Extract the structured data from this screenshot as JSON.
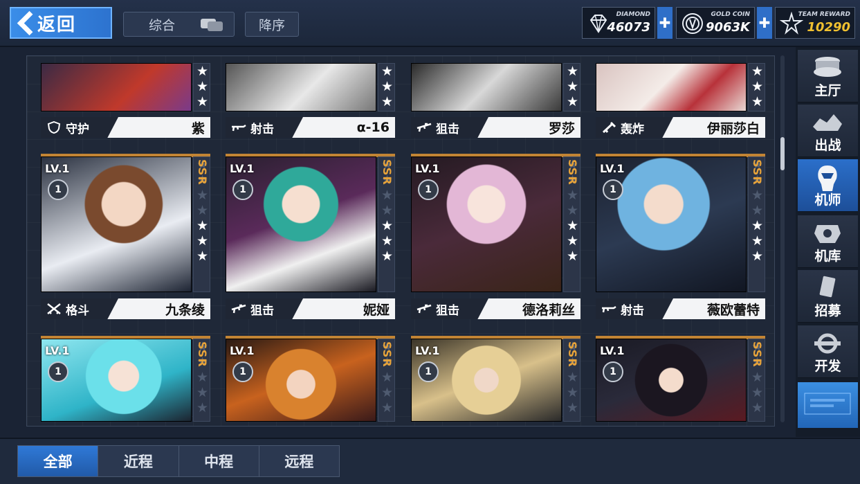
{
  "header": {
    "back_label": "返回",
    "sort_mode_label": "综合",
    "sort_order_label": "降序",
    "resources": [
      {
        "label": "DIAMOND",
        "value": "46073",
        "icon": "diamond-icon"
      },
      {
        "label": "GOLD COIN",
        "value": "9063K",
        "icon": "gold-coin-icon"
      },
      {
        "label": "TEAM REWARD",
        "value": "10290",
        "icon": "team-reward-icon"
      }
    ]
  },
  "roster": {
    "row1": [
      {
        "class": "守护",
        "name": "紫",
        "class_icon": "shield-icon",
        "stars": 3,
        "max_stars": 3
      },
      {
        "class": "射击",
        "name": "α-16",
        "class_icon": "rifle-icon",
        "stars": 3,
        "max_stars": 3
      },
      {
        "class": "狙击",
        "name": "罗莎",
        "class_icon": "sniper-icon",
        "stars": 3,
        "max_stars": 3
      },
      {
        "class": "轰炸",
        "name": "伊丽莎白",
        "class_icon": "bomb-launcher-icon",
        "stars": 3,
        "max_stars": 3
      }
    ],
    "row2": [
      {
        "level": "LV.1",
        "badge": "1",
        "rarity": "SSR",
        "class": "格斗",
        "name": "九条绫",
        "class_icon": "crossed-swords-icon",
        "stars": 3,
        "max_stars": 6
      },
      {
        "level": "LV.1",
        "badge": "1",
        "rarity": "SSR",
        "class": "狙击",
        "name": "妮娅",
        "class_icon": "sniper-icon",
        "stars": 3,
        "max_stars": 6
      },
      {
        "level": "LV.1",
        "badge": "1",
        "rarity": "SSR",
        "class": "狙击",
        "name": "德洛莉丝",
        "class_icon": "sniper-icon",
        "stars": 3,
        "max_stars": 6
      },
      {
        "level": "LV.1",
        "badge": "1",
        "rarity": "SSR",
        "class": "射击",
        "name": "薇欧蕾特",
        "class_icon": "rifle-icon",
        "stars": 3,
        "max_stars": 6
      }
    ],
    "row3": [
      {
        "level": "LV.1",
        "badge": "1",
        "rarity": "SSR"
      },
      {
        "level": "LV.1",
        "badge": "1",
        "rarity": "SSR"
      },
      {
        "level": "LV.1",
        "badge": "1",
        "rarity": "SSR"
      },
      {
        "level": "LV.1",
        "badge": "1",
        "rarity": "SSR"
      }
    ]
  },
  "sidenav": {
    "items": [
      {
        "label": "主厅",
        "icon": "main-hall-icon"
      },
      {
        "label": "出战",
        "icon": "sortie-icon"
      },
      {
        "label": "机师",
        "icon": "pilot-icon"
      },
      {
        "label": "机库",
        "icon": "hangar-icon"
      },
      {
        "label": "招募",
        "icon": "recruit-icon"
      },
      {
        "label": "开发",
        "icon": "develop-icon"
      }
    ],
    "active_index": 2
  },
  "filter_tabs": {
    "items": [
      "全部",
      "近程",
      "中程",
      "远程"
    ],
    "active_index": 0
  },
  "colors": {
    "accent_blue": "#2f79d7",
    "rarity_gold": "#e7a33a",
    "team_reward_yellow": "#f0c030"
  }
}
